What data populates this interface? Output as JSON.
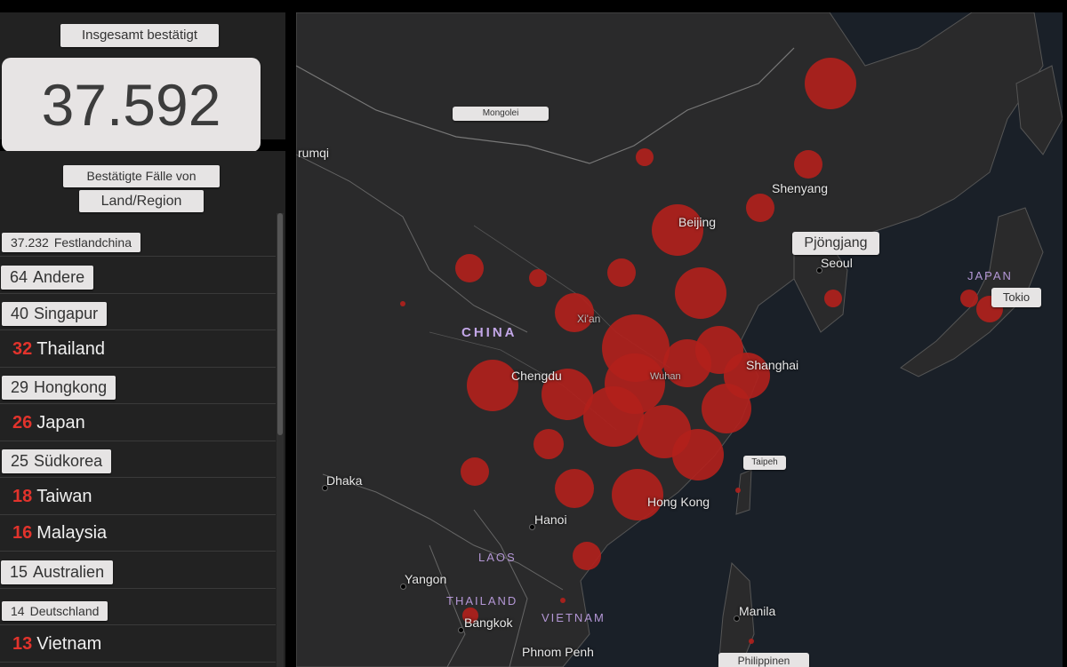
{
  "total": {
    "title": "Insgesamt bestätigt",
    "value": "37.592"
  },
  "list": {
    "title_line1": "Bestätigte Fälle von",
    "title_line2": "Land/Region",
    "rows": [
      {
        "count": "37.232",
        "name": "Festlandchina",
        "style": "paper"
      },
      {
        "count": "64",
        "name": "Andere",
        "style": "paper"
      },
      {
        "count": "40",
        "name": "Singapur",
        "style": "paper"
      },
      {
        "count": "32",
        "name": "Thailand",
        "style": "plain"
      },
      {
        "count": "29",
        "name": "Hongkong",
        "style": "paper"
      },
      {
        "count": "26",
        "name": "Japan",
        "style": "plain"
      },
      {
        "count": "25",
        "name": "Südkorea",
        "style": "paper"
      },
      {
        "count": "18",
        "name": "Taiwan",
        "style": "plain"
      },
      {
        "count": "16",
        "name": "Malaysia",
        "style": "plain"
      },
      {
        "count": "15",
        "name": "Australien",
        "style": "paper"
      },
      {
        "count": "14",
        "name": "Deutschland",
        "style": "paper"
      },
      {
        "count": "13",
        "name": "Vietnam",
        "style": "plain"
      }
    ]
  },
  "map": {
    "labels": {
      "mongolei": "Mongolei",
      "china": "CHINA",
      "japan": "JAPAN",
      "laos": "LAOS",
      "thailand": "THAILAND",
      "vietnam": "VIETNAM",
      "urumqi": "rumqi",
      "shenyang": "Shenyang",
      "beijing": "Beijing",
      "pyongyang": "Pjöngjang",
      "seoul": "Seoul",
      "tokio": "Tokio",
      "xian": "Xi'an",
      "chengdu": "Chengdu",
      "wuhan": "Wuhan",
      "shanghai": "Shanghai",
      "taipeh": "Taipeh",
      "dhaka": "Dhaka",
      "hongkong": "Hong Kong",
      "hanoi": "Hanoi",
      "yangon": "Yangon",
      "bangkok": "Bangkok",
      "manila": "Manila",
      "phnompenh": "Phnom Penh",
      "philippinen": "Philippinen"
    },
    "bubble_color": "#b3201c"
  },
  "colors": {
    "accent_red": "#e2332c",
    "panel_bg": "#222222",
    "map_bg": "#1b1c1e"
  }
}
